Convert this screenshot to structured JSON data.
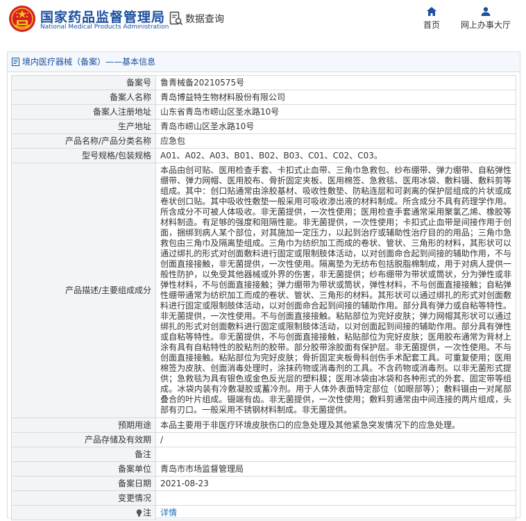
{
  "header": {
    "brand_cn": "国家药品监督管理局",
    "brand_en": "National Medical Products Administration",
    "search_label": "数据查询",
    "nav": {
      "home": "首页",
      "office": "网上办事大厅"
    },
    "colors": {
      "brand": "#1b4fa1",
      "emblem": "#d61f26"
    }
  },
  "panel": {
    "title": "境内医疗器械（备案）——基本信息"
  },
  "rows": [
    {
      "k": "备案号",
      "v": "鲁青械备20210575号"
    },
    {
      "k": "备案人名称",
      "v": "青岛博益特生物材料股份有限公司"
    },
    {
      "k": "备案人注册地址",
      "v": "山东省青岛市崂山区圣水路10号"
    },
    {
      "k": "生产地址",
      "v": "青岛市崂山区圣水路10号"
    },
    {
      "k": "产品名称/产品分类名称",
      "v": "应急包"
    },
    {
      "k": "型号规格/包装规格",
      "v": "A01、A02、A03、B01、B02、B03、C01、C02、C03。"
    },
    {
      "k": "产品描述/主要组成成分",
      "v": "本品由创可贴、医用检查手套、卡扣式止血带、三角巾急救包、纱布绷带、弹力绷带、自粘弹性绷带、弹力网帽、医用胶布、骨折固定夹板、医用棉签、急救毯、医用冰袋、敷料镊、敷料剪等组成。其中：创口贴通常由涂胶基材、吸收性敷垫、防粘连层和可剥离的保护层组成的片状或成卷状创口贴。其中吸收性敷垫一般采用可吸收渗出液的材料制成。所含成分不具有药理学作用。所含成分不可被人体吸收。非无菌提供，一次性使用；医用检查手套通常采用聚氯乙烯、橡胶等材料制造。有足够的强度和阻隔性能。非无菌提供，一次性使用；卡扣式止血带是间接作用于创面，捆绑到病人某个部位，对其施加一定压力，以起到治疗或辅助性治疗目的的用品；三角巾急救包由三角巾及隔离垫组成。三角巾为纺织加工而成的卷状、管状、三角形的材料，其形状可以通过绑扎的形式对创面敷料进行固定或限制肢体活动，以对创面命合起到间接的辅助作用，不与创面直接接触，非无菌提供，一次性使用。隔离垫为无纺布包括脱脂棉制成，用于对病人提供一般性防护，以免受其他器械或外界的伤害，非无菌提供；纱布绷带为带状或筒状，分为弹性或非弹性材料，不与创面直接接触；弹力绷带为带状或筒状，弹性材料，不与创面直接接触；自粘弹性绷带通常为纺织加工而成的卷状、管状、三角形的材料。其形状可以通过绑扎的形式对创面敷料进行固定或限制肢体活动，以对创面命合起到间接的辅助作用。部分具有弹力或自粘等特性。非无菌提供，一次性使用。不与创面直接接触。粘贴部位为完好皮肤；弹力网帽其形状可以通过绑扎的形式对创面敷料进行固定或限制肢体活动，以对创面起到间接的辅助作用。部分具有弹性或自粘等特性。非无菌提供，不与创面直接接触，粘贴部位为完好皮肤；医用胶布通常为背材上涂有具有自粘特性的胶粘剂的胶带。部分胶带涂胶面有保护层。非无菌提供，一次性使用。不与创面直接接触。粘贴部位为完好皮肤；骨折固定夹板骨科创伤手术配套工具。可重复使用；医用棉签为皮肤、创面消毒处理时，涂抹药物或消毒剂的工具。不含药物或消毒剂。以非无菌形式提供；急救毯为具有银色或金色反光层的塑料膜；医用冰袋由冰袋和各种形式的外套、固定带等组成。冰袋内装有冷敷凝胶或蓄冷剂。用于人体外表面特定部位（如眼部等）；敷料镊由一对尾部叠合的叶片组成。镊端有齿。非无菌提供，一次性使用；敷料剪通常由中间连接的两片组成，头部有刃口。一般采用不锈钢材料制成。非无菌提供。"
    },
    {
      "k": "预期用途",
      "v": "本品主要用于非医疗环境皮肤伤口的应急处理及其他紧急突发情况下的应急处理。"
    },
    {
      "k": "产品存储及有效期",
      "v": "/"
    },
    {
      "k": "备注",
      "v": ""
    },
    {
      "k": "备案单位",
      "v": "青岛市市场监督管理局"
    },
    {
      "k": "备案日期",
      "v": "2021-08-23"
    },
    {
      "k": "变更情况",
      "v": ""
    },
    {
      "k": "注",
      "v": "详情"
    }
  ]
}
